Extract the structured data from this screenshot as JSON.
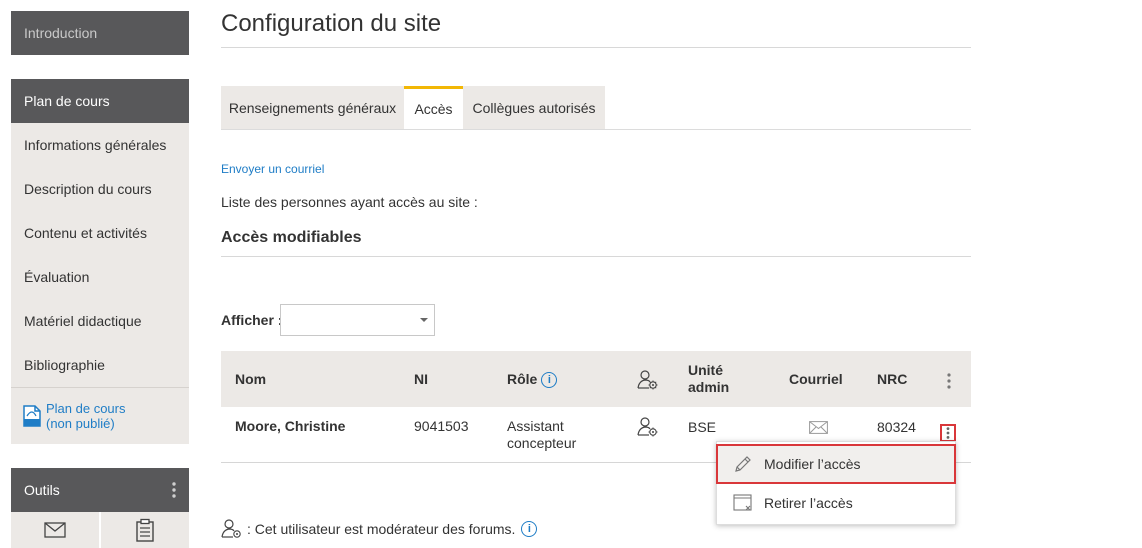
{
  "sidebar": {
    "intro": "Introduction",
    "plan_header": "Plan de cours",
    "items": [
      {
        "label": "Informations générales"
      },
      {
        "label": "Description du cours"
      },
      {
        "label": "Contenu et activités"
      },
      {
        "label": "Évaluation"
      },
      {
        "label": "Matériel didactique"
      },
      {
        "label": "Bibliographie"
      }
    ],
    "pdf_link": {
      "line1": "Plan de cours",
      "line2": "(non publié)"
    },
    "tools_header": "Outils"
  },
  "main": {
    "title": "Configuration du site",
    "tabs": [
      {
        "label": "Renseignements généraux",
        "active": false
      },
      {
        "label": "Accès",
        "active": true
      },
      {
        "label": "Collègues autorisés",
        "active": false
      }
    ],
    "send_email_link": "Envoyer un courriel",
    "list_label": "Liste des personnes ayant accès au site :",
    "section_title": "Accès modifiables",
    "show_label": "Afficher :",
    "show_value": ""
  },
  "table": {
    "headers": {
      "name": "Nom",
      "ni": "NI",
      "role": "Rôle",
      "unit_line1": "Unité",
      "unit_line2": "admin",
      "email": "Courriel",
      "nrc": "NRC"
    },
    "rows": [
      {
        "name": "Moore, Christine",
        "ni": "9041503",
        "role_line1": "Assistant",
        "role_line2": "concepteur",
        "unit": "BSE",
        "nrc": "80324"
      }
    ]
  },
  "context_menu": {
    "items": [
      {
        "label": "Modifier l’accès",
        "icon": "pencil-icon"
      },
      {
        "label": "Retirer l’accès",
        "icon": "remove-window-icon"
      }
    ]
  },
  "footnote": ": Cet utilisateur est modérateur des forums.",
  "colors": {
    "accent_tab": "#f2b705",
    "link": "#1f7dc6",
    "highlight_border": "#d9373a",
    "sidebar_dark": "#58585a",
    "sidebar_light": "#ece9e6"
  }
}
